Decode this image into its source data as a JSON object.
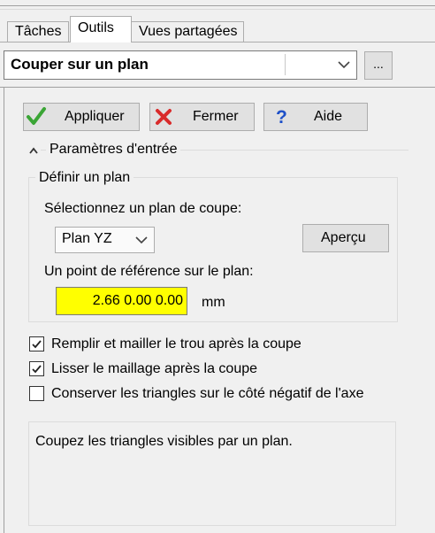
{
  "tabs": [
    {
      "label": "Tâches"
    },
    {
      "label": "Outils"
    },
    {
      "label": "Vues partagées"
    }
  ],
  "tool_selector": {
    "value": "Couper sur un plan",
    "more_label": "..."
  },
  "actions": {
    "apply_label": "Appliquer",
    "close_label": "Fermer",
    "help_label": "Aide",
    "icons": {
      "apply": "check-icon",
      "close": "x-icon",
      "help": "question-icon"
    },
    "colors": {
      "apply": "#3aa535",
      "close": "#d92b2b",
      "help": "#1e50c8"
    }
  },
  "section": {
    "title": "Paramètres d'entrée",
    "collapse_icon": "chevron-up-icon"
  },
  "plane_group": {
    "title": "Définir un plan",
    "select_label": "Sélectionnez un plan de coupe:",
    "plane_value": "Plan YZ",
    "preview_label": "Aperçu",
    "point_label": "Un point de référence sur le plan:",
    "point_value": "2.66 0.00 0.00",
    "point_bg": "#ffff00",
    "unit": "mm"
  },
  "options": [
    {
      "label": "Remplir et mailler le trou après la coupe",
      "checked": true
    },
    {
      "label": "Lisser le maillage après la coupe",
      "checked": true
    },
    {
      "label": "Conserver les triangles sur le côté négatif de l'axe",
      "checked": false
    }
  ],
  "description": "Coupez les triangles visibles par un plan."
}
